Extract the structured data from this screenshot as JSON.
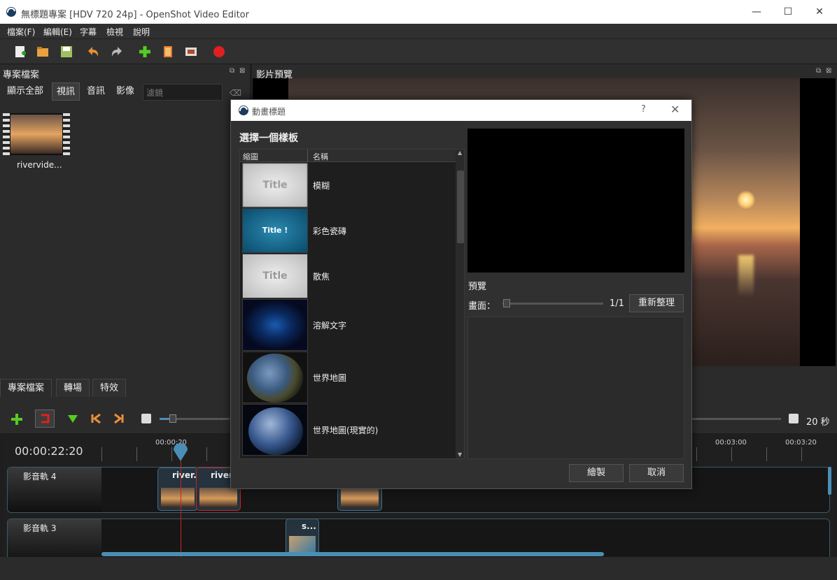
{
  "window": {
    "title": "無標題專案 [HDV 720 24p] - OpenShot Video Editor",
    "minimize": "—",
    "maximize": "☐",
    "close": "✕"
  },
  "menu": [
    "檔案(F)",
    "編輯(E)",
    "字幕",
    "檢視",
    "說明"
  ],
  "project_files": {
    "title": "專案檔案",
    "filters": [
      "顯示全部",
      "視訊",
      "音訊",
      "影像"
    ],
    "active_filter": "視訊",
    "filter_placeholder": "濾鏡",
    "files": [
      {
        "name": "rivervide..."
      }
    ]
  },
  "video_preview": {
    "title": "影片預覽"
  },
  "bottom_tabs": [
    "專案檔案",
    "轉場",
    "特效"
  ],
  "timeline": {
    "timecode": "00:00:22:20",
    "zoom_label": "20 秒",
    "ruler_labels": [
      "00:00:20",
      "00:03:00",
      "00:03:20"
    ],
    "tracks": [
      {
        "name": "影音軌 4",
        "clips": [
          "river..",
          "river"
        ]
      },
      {
        "name": "影音軌 3",
        "clips": [
          "s..."
        ]
      }
    ]
  },
  "dialog": {
    "title": "動畫標題",
    "help": "?",
    "close": "✕",
    "heading": "選擇一個樣板",
    "columns": [
      "縮圖",
      "名稱"
    ],
    "templates": [
      {
        "name": "模糊",
        "thumb_text": "Title"
      },
      {
        "name": "彩色瓷磚",
        "thumb_text": "Title !"
      },
      {
        "name": "散焦",
        "thumb_text": "Title"
      },
      {
        "name": "溶解文字",
        "thumb_text": ""
      },
      {
        "name": "世界地圖",
        "thumb_text": ""
      },
      {
        "name": "世界地圖(現實的)",
        "thumb_text": ""
      }
    ],
    "preview_label": "預覽",
    "frame_label": "畫面：",
    "frame_value": "1/1",
    "refresh_button": "重新整理",
    "render_button": "繪製",
    "cancel_button": "取消"
  },
  "colors": {
    "accent": "#4a8eb5",
    "playhead": "#cc2222",
    "record": "#e02020"
  }
}
